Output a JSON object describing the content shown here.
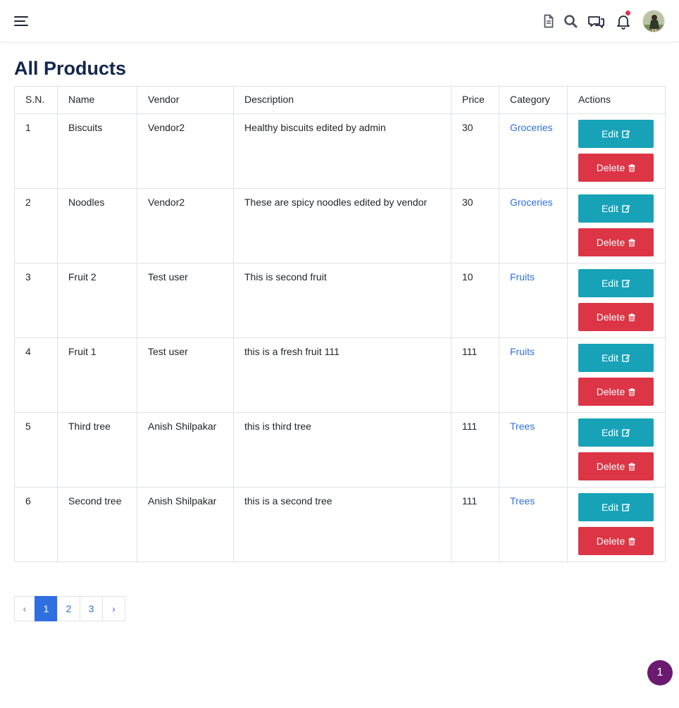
{
  "page": {
    "title": "All Products"
  },
  "table": {
    "headers": [
      "S.N.",
      "Name",
      "Vendor",
      "Description",
      "Price",
      "Category",
      "Actions"
    ],
    "rows": [
      {
        "sn": "1",
        "name": "Biscuits",
        "vendor": "Vendor2",
        "description": "Healthy biscuits edited by admin",
        "price": "30",
        "category": "Groceries"
      },
      {
        "sn": "2",
        "name": "Noodles",
        "vendor": "Vendor2",
        "description": "These are spicy noodles edited by vendor",
        "price": "30",
        "category": "Groceries"
      },
      {
        "sn": "3",
        "name": "Fruit 2",
        "vendor": "Test user",
        "description": "This is second fruit",
        "price": "10",
        "category": "Fruits"
      },
      {
        "sn": "4",
        "name": "Fruit 1",
        "vendor": "Test user",
        "description": "this is a fresh fruit 111",
        "price": "111",
        "category": "Fruits"
      },
      {
        "sn": "5",
        "name": "Third tree",
        "vendor": "Anish Shilpakar",
        "description": "this is third tree",
        "price": "111",
        "category": "Trees"
      },
      {
        "sn": "6",
        "name": "Second tree",
        "vendor": "Anish Shilpakar",
        "description": "this is a second tree",
        "price": "111",
        "category": "Trees"
      }
    ],
    "actions": {
      "edit_label": "Edit",
      "delete_label": "Delete",
      "edit_icon": "edit-icon",
      "delete_icon": "trash-icon"
    }
  },
  "pagination": {
    "prev": "‹",
    "pages": [
      "1",
      "2",
      "3"
    ],
    "next": "›",
    "active_page": "1"
  },
  "floating_badge": {
    "label": "1"
  },
  "nav_icons": [
    "menu-icon",
    "document-icon",
    "search-icon",
    "chat-icon",
    "bell-icon",
    "avatar"
  ],
  "colors": {
    "title": "#14264d",
    "edit_button": "#17a2b8",
    "delete_button": "#dc3545",
    "link": "#2f6fe0",
    "badge": "#6a1b6f",
    "notification_dot": "#dc3545"
  }
}
